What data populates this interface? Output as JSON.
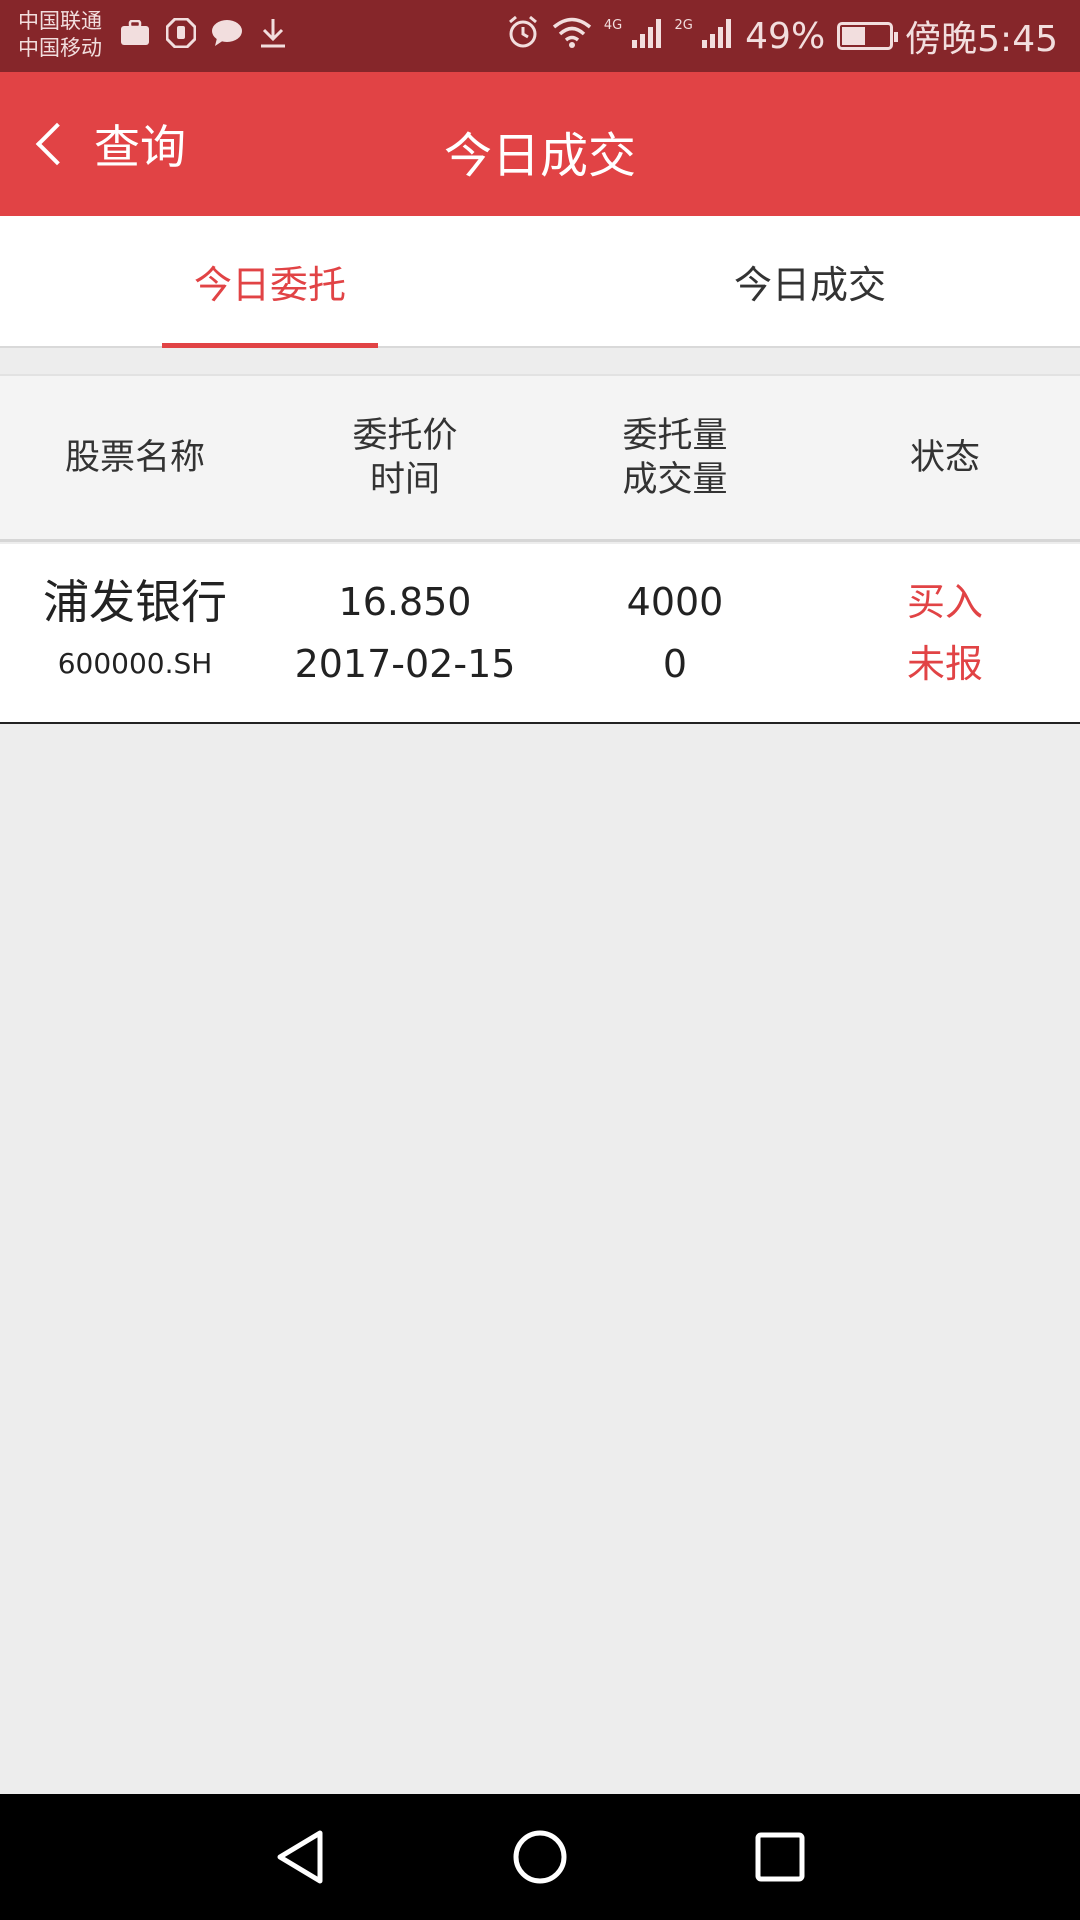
{
  "status_bar": {
    "carrier1": "中国联通",
    "carrier2": "中国移动",
    "net1": "4G",
    "net2": "2G",
    "battery": "49%",
    "time": "傍晚5:45"
  },
  "header": {
    "back_label": "查询",
    "title": "今日成交"
  },
  "tabs": [
    {
      "label": "今日委托",
      "active": true
    },
    {
      "label": "今日成交",
      "active": false
    }
  ],
  "table": {
    "columns": [
      {
        "line1": "股票名称",
        "line2": ""
      },
      {
        "line1": "委托价",
        "line2": "时间"
      },
      {
        "line1": "委托量",
        "line2": "成交量"
      },
      {
        "line1": "状态",
        "line2": ""
      }
    ],
    "rows": [
      {
        "name": "浦发银行",
        "code": "600000.SH",
        "price": "16.850",
        "date": "2017-02-15",
        "order_qty": "4000",
        "filled_qty": "0",
        "direction": "买入",
        "status": "未报"
      }
    ]
  },
  "colors": {
    "accent": "#e14345",
    "status_bar": "#86262a"
  }
}
